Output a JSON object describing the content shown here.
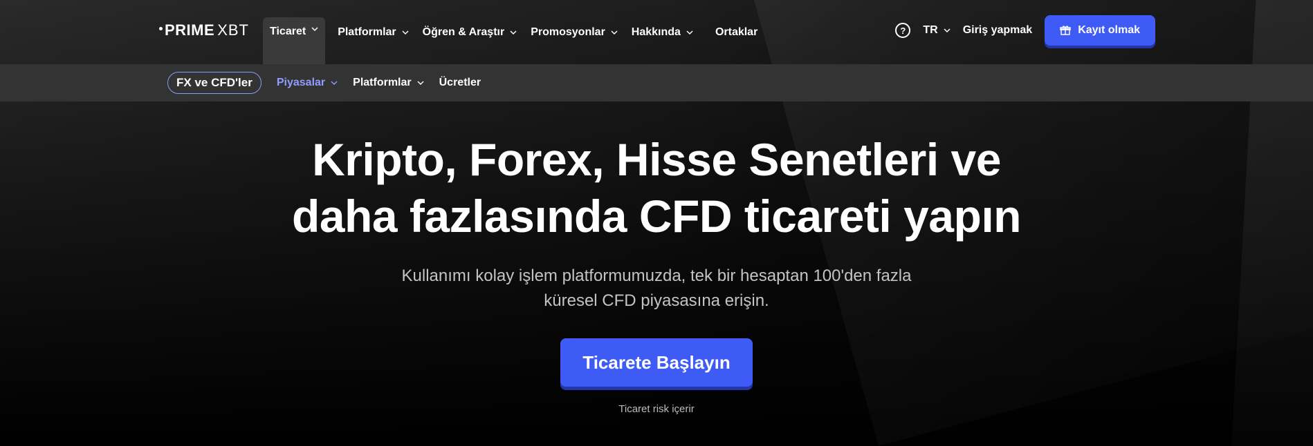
{
  "brand": {
    "prime": "PRIME",
    "xbt": "XBT"
  },
  "topnav": {
    "items": [
      {
        "label": "Ticaret",
        "has_dropdown": true,
        "active": true
      },
      {
        "label": "Platformlar",
        "has_dropdown": true
      },
      {
        "label": "Öğren & Araştır",
        "has_dropdown": true
      },
      {
        "label": "Promosyonlar",
        "has_dropdown": true
      },
      {
        "label": "Hakkında",
        "has_dropdown": true
      },
      {
        "label": "Ortaklar",
        "has_dropdown": false
      }
    ],
    "help_icon": "question-circle-icon",
    "language": "TR",
    "login": "Giriş yapmak",
    "signup": "Kayıt olmak",
    "signup_icon": "gift-icon"
  },
  "subnav": {
    "section": "FX ve CFD'ler",
    "items": [
      {
        "label": "Piyasalar",
        "has_dropdown": true,
        "active": true
      },
      {
        "label": "Platformlar",
        "has_dropdown": true
      },
      {
        "label": "Ücretler",
        "has_dropdown": false
      }
    ]
  },
  "hero": {
    "title_line1": "Kripto, Forex, Hisse Senetleri ve",
    "title_line2": "daha fazlasında CFD ticareti yapın",
    "subtitle_line1": "Kullanımı kolay işlem platformumuzda, tek bir hesaptan 100'den fazla",
    "subtitle_line2": "küresel CFD piyasasına erişin.",
    "cta": "Ticarete Başlayın",
    "risk_note": "Ticaret risk içerir"
  },
  "colors": {
    "accent": "#3f5bf6",
    "subnav_active": "#8f9dff",
    "subnav_bg": "#333333"
  }
}
